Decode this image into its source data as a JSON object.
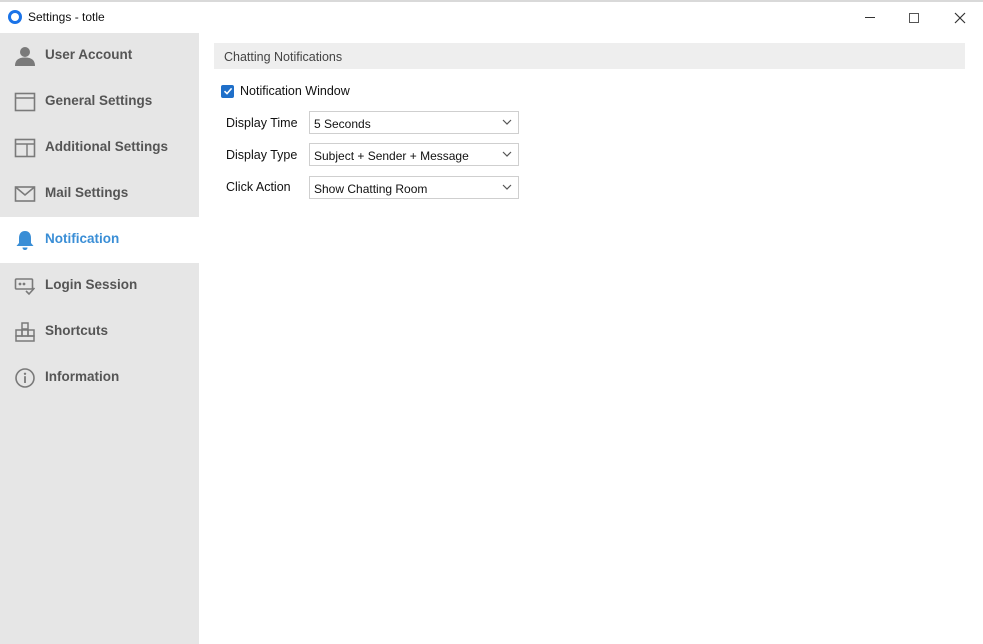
{
  "window": {
    "title": "Settings - totle"
  },
  "sidebar": {
    "items": [
      {
        "label": "User Account",
        "icon": "user-icon",
        "active": false
      },
      {
        "label": "General Settings",
        "icon": "window-icon",
        "active": false
      },
      {
        "label": "Additional Settings",
        "icon": "panel-icon",
        "active": false
      },
      {
        "label": "Mail Settings",
        "icon": "mail-icon",
        "active": false
      },
      {
        "label": "Notification",
        "icon": "bell-icon",
        "active": true
      },
      {
        "label": "Login Session",
        "icon": "session-icon",
        "active": false
      },
      {
        "label": "Shortcuts",
        "icon": "keyboard-icon",
        "active": false
      },
      {
        "label": "Information",
        "icon": "info-icon",
        "active": false
      }
    ]
  },
  "main": {
    "section_title": "Chatting Notifications",
    "notification_window": {
      "label": "Notification Window",
      "checked": true
    },
    "fields": [
      {
        "label": "Display Time",
        "value": "5 Seconds"
      },
      {
        "label": "Display Type",
        "value": "Subject + Sender + Message"
      },
      {
        "label": "Click Action",
        "value": "Show Chatting Room"
      }
    ]
  },
  "colors": {
    "accent": "#3a8ed6",
    "checkbox": "#1f6fc9",
    "sidebar_bg": "#e6e6e6",
    "section_bg": "#eeeeee"
  }
}
